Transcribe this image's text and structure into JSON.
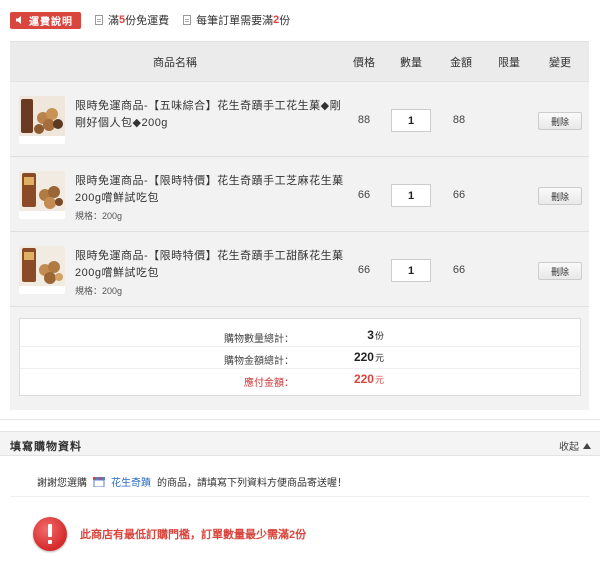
{
  "topbar": {
    "notice_label": "運費說明",
    "free_shipping_prefix": "滿",
    "free_shipping_count": "5",
    "free_shipping_suffix": "份免運費",
    "min_order_prefix": "每筆訂單需要滿",
    "min_order_count": "2",
    "min_order_suffix": "份"
  },
  "cart": {
    "columns": [
      "商品名稱",
      "價格",
      "數量",
      "金額",
      "限量",
      "變更"
    ],
    "items": [
      {
        "title": "限時免運商品-【五味綜合】花生奇蹟手工花生菓◆剛剛好個人包◆200g",
        "spec": "",
        "price": "88",
        "qty": "1",
        "amount": "88",
        "delete_label": "刪除"
      },
      {
        "title": "限時免運商品-【限時特價】花生奇蹟手工芝麻花生菓 200g嚐鮮試吃包",
        "spec": "規格：200g",
        "price": "66",
        "qty": "1",
        "amount": "66",
        "delete_label": "刪除"
      },
      {
        "title": "限時免運商品-【限時特價】花生奇蹟手工甜酥花生菓 200g嚐鮮試吃包",
        "spec": "規格：200g",
        "price": "66",
        "qty": "1",
        "amount": "66",
        "delete_label": "刪除"
      }
    ],
    "summary": {
      "qty_label": "購物數量總計：",
      "qty_value": "3",
      "qty_unit": "份",
      "amount_label": "購物金額總計：",
      "amount_value": "220",
      "amount_unit": "元",
      "pay_label": "應付金額：",
      "pay_value": "220",
      "pay_unit": "元"
    }
  },
  "purchase_info": {
    "title": "填寫購物資料",
    "collapse_label": "收起",
    "thanks_prefix": "謝謝您選購",
    "shop_name": "花生奇蹟",
    "thanks_suffix": "的商品，請填寫下列資料方便商品寄送喔！",
    "warning": "此商店有最低訂購門檻，訂單數量最少需滿2份"
  },
  "colors": {
    "accent": "#d9463e",
    "link": "#2a6cc4"
  }
}
